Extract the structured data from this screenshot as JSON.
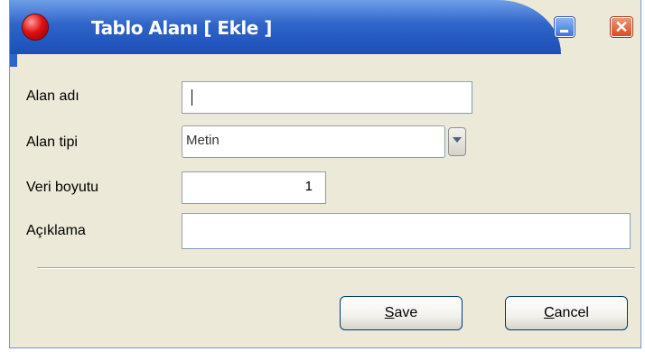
{
  "window": {
    "title": "Tablo Alanı [ Ekle ]",
    "app_icon": "red-orb-icon",
    "minimize_icon": "minimize-icon",
    "close_icon": "close-icon"
  },
  "form": {
    "field_name": {
      "label": "Alan adı",
      "value": ""
    },
    "field_type": {
      "label": "Alan tipi",
      "value": "Metin"
    },
    "data_size": {
      "label": "Veri boyutu",
      "value": "1"
    },
    "description": {
      "label": "Açıklama",
      "value": ""
    }
  },
  "buttons": {
    "save": {
      "accel": "S",
      "rest": "ave"
    },
    "cancel": {
      "accel": "C",
      "rest": "ancel"
    }
  },
  "colors": {
    "titlebar": "#2f64c8",
    "close": "#d8461e",
    "dialog_bg": "#ece9d8"
  }
}
